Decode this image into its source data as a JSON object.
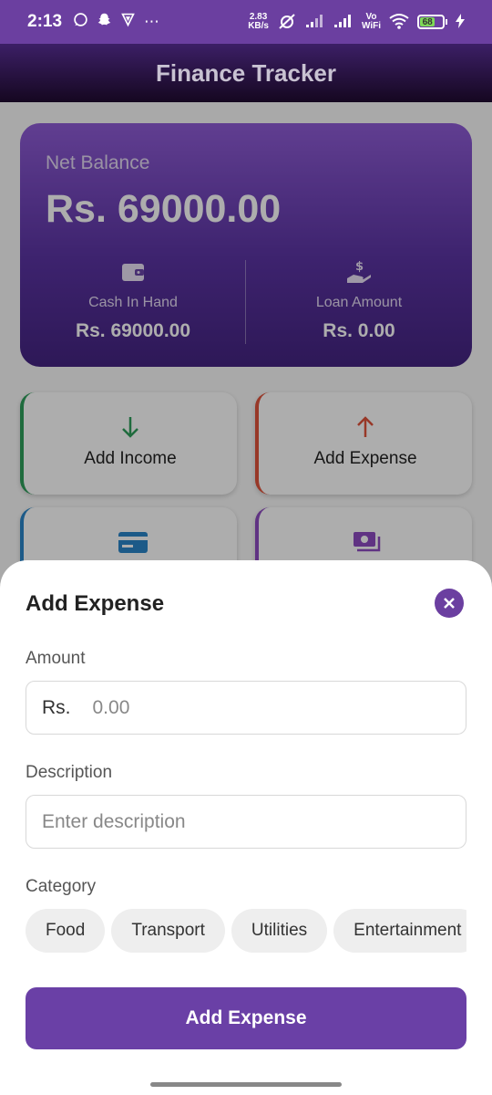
{
  "status_bar": {
    "time": "2:13",
    "net_speed_top": "2.83",
    "net_speed_bottom": "KB/s",
    "vo_label": "Vo",
    "wifi_label": "WiFi",
    "battery_level": "68",
    "battery_color": "#7ed957"
  },
  "app_bar": {
    "title": "Finance Tracker"
  },
  "balance_card": {
    "label": "Net Balance",
    "amount": "Rs. 69000.00",
    "cash": {
      "label": "Cash In Hand",
      "value": "Rs. 69000.00",
      "icon": "wallet-icon"
    },
    "loan": {
      "label": "Loan Amount",
      "value": "Rs. 0.00",
      "icon": "hand-dollar-icon"
    }
  },
  "actions": {
    "income": {
      "label": "Add Income",
      "icon": "arrow-down-icon",
      "color": "#2e9e5b"
    },
    "expense": {
      "label": "Add Expense",
      "icon": "arrow-up-icon",
      "color": "#e0533b"
    },
    "card3": {
      "icon": "credit-card-icon",
      "color": "#2a85c9"
    },
    "card4": {
      "icon": "money-icon",
      "color": "#8e4cc1"
    }
  },
  "sheet": {
    "title": "Add Expense",
    "amount_label": "Amount",
    "amount_prefix": "Rs.",
    "amount_placeholder": "0.00",
    "description_label": "Description",
    "description_placeholder": "Enter description",
    "category_label": "Category",
    "categories": [
      "Food",
      "Transport",
      "Utilities",
      "Entertainment"
    ],
    "submit_label": "Add Expense",
    "accent": "#6a40a6"
  }
}
